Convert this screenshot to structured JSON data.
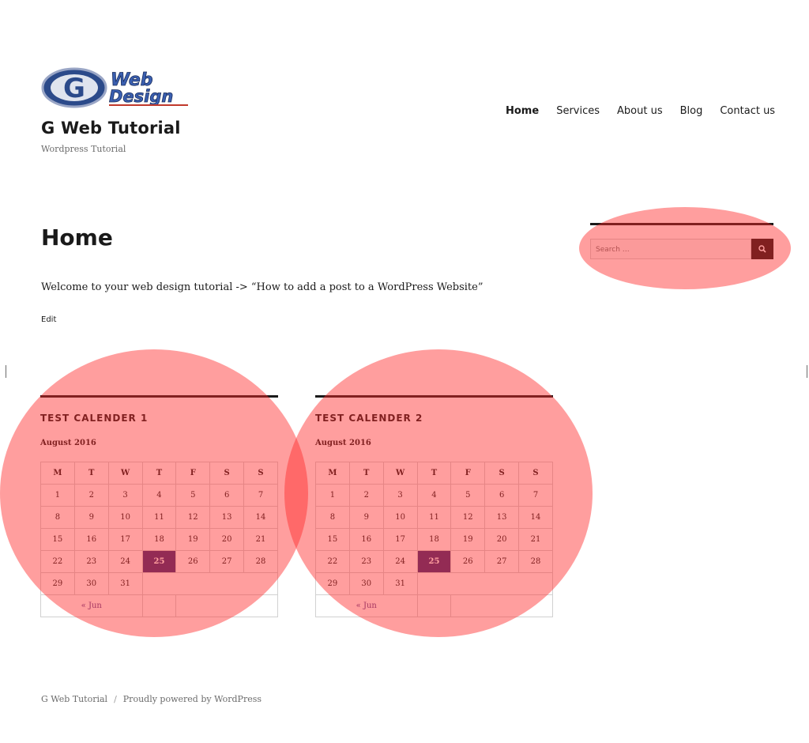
{
  "site": {
    "title": "G Web Tutorial",
    "tagline": "Wordpress Tutorial",
    "logo_text_1": "Web",
    "logo_text_2": "Design",
    "logo_letter": "G"
  },
  "nav": {
    "items": [
      {
        "label": "Home",
        "current": true
      },
      {
        "label": "Services"
      },
      {
        "label": "About us"
      },
      {
        "label": "Blog"
      },
      {
        "label": "Contact us"
      }
    ]
  },
  "page": {
    "title": "Home",
    "intro": "Welcome to your web design tutorial -> “How to add a post to a WordPress Website”",
    "edit_label": "Edit"
  },
  "search": {
    "placeholder": "Search …",
    "icon": "search-icon"
  },
  "calendars": [
    {
      "title": "TEST CALENDER 1",
      "caption": "August 2016",
      "weekdays": [
        "M",
        "T",
        "W",
        "T",
        "F",
        "S",
        "S"
      ],
      "prev_label": "« Jun",
      "today": "25"
    },
    {
      "title": "TEST CALENDER 2",
      "caption": "August 2016",
      "weekdays": [
        "M",
        "T",
        "W",
        "T",
        "F",
        "S",
        "S"
      ],
      "prev_label": "« Jun",
      "today": "25"
    }
  ],
  "calendar_weeks": [
    [
      "1",
      "2",
      "3",
      "4",
      "5",
      "6",
      "7"
    ],
    [
      "8",
      "9",
      "10",
      "11",
      "12",
      "13",
      "14"
    ],
    [
      "15",
      "16",
      "17",
      "18",
      "19",
      "20",
      "21"
    ],
    [
      "22",
      "23",
      "24",
      "25",
      "26",
      "27",
      "28"
    ],
    [
      "29",
      "30",
      "31"
    ]
  ],
  "footer": {
    "site_link": "G Web Tutorial",
    "separator": "/",
    "powered": "Proudly powered by WordPress"
  },
  "colors": {
    "highlight": "#ff2828",
    "today_bg": "#3b2f78",
    "text": "#1a1a1a"
  }
}
